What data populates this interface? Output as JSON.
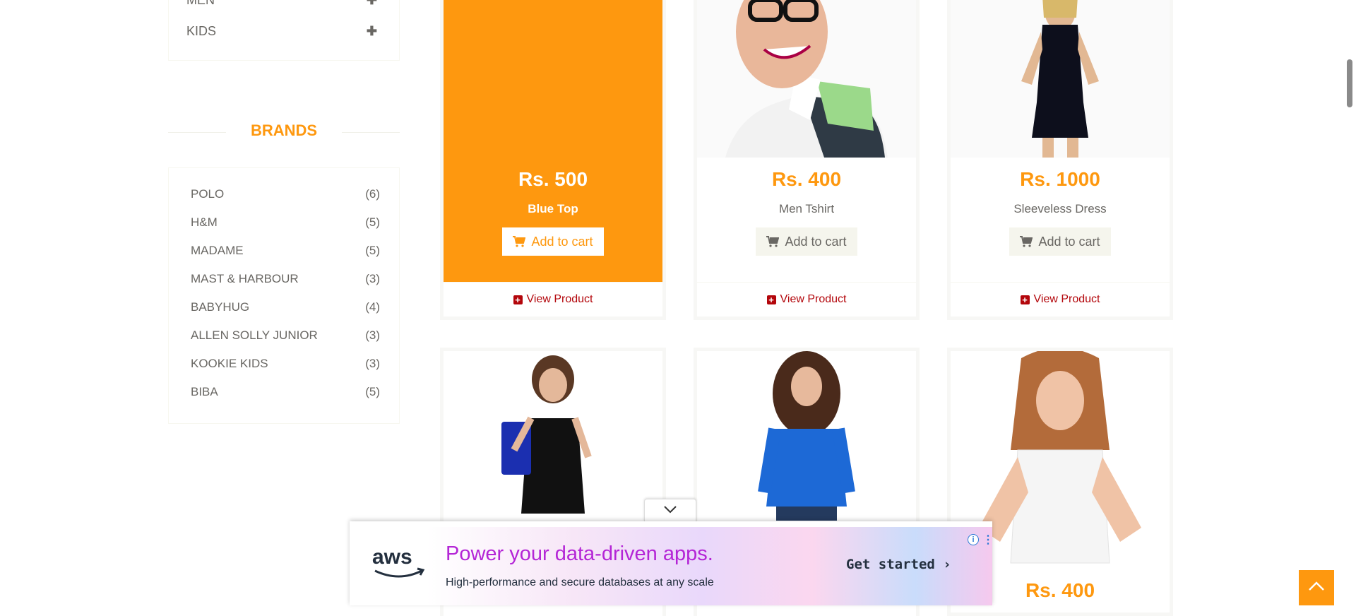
{
  "categories": [
    {
      "label": "MEN"
    },
    {
      "label": "KIDS"
    }
  ],
  "brands": {
    "title": "BRANDS",
    "items": [
      {
        "name": "POLO",
        "count": "(6)"
      },
      {
        "name": "H&M",
        "count": "(5)"
      },
      {
        "name": "MADAME",
        "count": "(5)"
      },
      {
        "name": "MAST & HARBOUR",
        "count": "(3)"
      },
      {
        "name": "BABYHUG",
        "count": "(4)"
      },
      {
        "name": "ALLEN SOLLY JUNIOR",
        "count": "(3)"
      },
      {
        "name": "KOOKIE KIDS",
        "count": "(3)"
      },
      {
        "name": "BIBA",
        "count": "(5)"
      }
    ]
  },
  "products": [
    {
      "price": "Rs. 500",
      "name": "Blue Top",
      "cart_label": "Add to cart",
      "view_label": "View Product"
    },
    {
      "price": "Rs. 400",
      "name": "Men Tshirt",
      "cart_label": "Add to cart",
      "view_label": "View Product"
    },
    {
      "price": "Rs. 1000",
      "name": "Sleeveless Dress",
      "cart_label": "Add to cart",
      "view_label": "View Product"
    },
    {
      "price": "Rs. 400"
    }
  ],
  "ad": {
    "brand": "aws",
    "headline": "Power your data-driven apps.",
    "subline": "High-performance and secure databases at any scale",
    "cta": "Get started ›"
  },
  "colors": {
    "accent": "#FE980F",
    "link_red": "#B3060B",
    "text": "#696763"
  }
}
